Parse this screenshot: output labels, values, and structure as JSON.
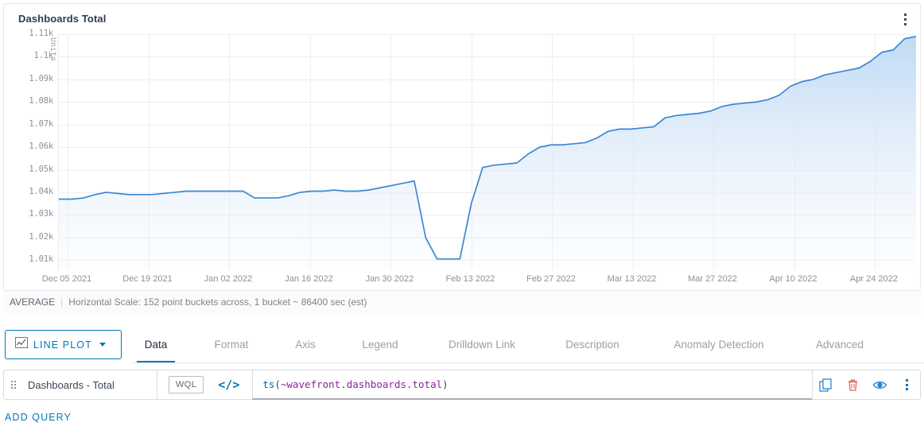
{
  "chart_card": {
    "title": "Dashboards Total",
    "menu_icon": "kebab-menu-icon"
  },
  "chart_data": {
    "type": "area",
    "title": "Dashboards Total",
    "xlabel": "",
    "ylabel": "Units",
    "ylim": [
      1005,
      1115
    ],
    "ytick_labels": [
      "1.11k",
      "1.1k",
      "1.09k",
      "1.08k",
      "1.07k",
      "1.06k",
      "1.05k",
      "1.04k",
      "1.03k",
      "1.02k",
      "1.01k"
    ],
    "ytick_values": [
      1110,
      1100,
      1090,
      1080,
      1070,
      1060,
      1050,
      1040,
      1030,
      1020,
      1010
    ],
    "xtick_labels": [
      "Dec 05 2021",
      "Dec 19 2021",
      "Jan 02 2022",
      "Jan 16 2022",
      "Jan 30 2022",
      "Feb 13 2022",
      "Feb 27 2022",
      "Mar 13 2022",
      "Mar 27 2022",
      "Apr 10 2022",
      "Apr 24 2022"
    ],
    "grid": true,
    "legend": "none",
    "series": [
      {
        "name": "Dashboards - Total",
        "color": "#3a87d4",
        "fill_color": "#cfe2f6",
        "x": [
          "2021-11-30",
          "2021-12-02",
          "2021-12-04",
          "2021-12-06",
          "2021-12-08",
          "2021-12-10",
          "2021-12-12",
          "2021-12-14",
          "2021-12-16",
          "2021-12-18",
          "2021-12-20",
          "2021-12-22",
          "2021-12-24",
          "2021-12-26",
          "2021-12-28",
          "2021-12-30",
          "2022-01-01",
          "2022-01-03",
          "2022-01-05",
          "2022-01-07",
          "2022-01-09",
          "2022-01-11",
          "2022-01-13",
          "2022-01-15",
          "2022-01-17",
          "2022-01-19",
          "2022-01-21",
          "2022-01-23",
          "2022-01-25",
          "2022-01-27",
          "2022-01-29",
          "2022-01-31",
          "2022-02-02",
          "2022-02-04",
          "2022-02-06",
          "2022-02-08",
          "2022-02-10",
          "2022-02-12",
          "2022-02-14",
          "2022-02-16",
          "2022-02-18",
          "2022-02-20",
          "2022-02-22",
          "2022-02-24",
          "2022-02-26",
          "2022-02-28",
          "2022-03-02",
          "2022-03-04",
          "2022-03-06",
          "2022-03-08",
          "2022-03-10",
          "2022-03-12",
          "2022-03-14",
          "2022-03-16",
          "2022-03-18",
          "2022-03-20",
          "2022-03-22",
          "2022-03-24",
          "2022-03-26",
          "2022-03-28",
          "2022-03-30",
          "2022-04-01",
          "2022-04-03",
          "2022-04-05",
          "2022-04-07",
          "2022-04-09",
          "2022-04-11",
          "2022-04-13",
          "2022-04-15",
          "2022-04-17",
          "2022-04-19",
          "2022-04-21",
          "2022-04-23",
          "2022-04-25",
          "2022-04-27",
          "2022-04-29",
          "2022-05-01"
        ],
        "values": [
          1037,
          1037,
          1037,
          1037.5,
          1039,
          1040,
          1039.5,
          1039,
          1039,
          1039,
          1039.5,
          1040,
          1040.5,
          1040.5,
          1040.5,
          1040.5,
          1040.5,
          1040.5,
          1037.5,
          1037.5,
          1037.5,
          1038.5,
          1040,
          1040.5,
          1040.5,
          1041,
          1040.5,
          1040.5,
          1041,
          1042,
          1043,
          1044,
          1045,
          1020,
          1010.5,
          1010.5,
          1010.5,
          1035,
          1051,
          1052,
          1052.5,
          1053,
          1057,
          1060,
          1061,
          1061,
          1061.5,
          1062,
          1064,
          1067,
          1068,
          1068,
          1068.5,
          1069,
          1073,
          1074,
          1074.5,
          1075,
          1076,
          1078,
          1079,
          1079.5,
          1080,
          1081,
          1083,
          1087,
          1089,
          1090,
          1092,
          1093,
          1094,
          1095,
          1098,
          1102,
          1103,
          1108,
          1109
        ]
      }
    ]
  },
  "chart_footer": {
    "aggregation": "AVERAGE",
    "separator": "|",
    "scale_text": "Horizontal Scale: 152 point buckets across, 1 bucket ~ 86400 sec (est)"
  },
  "plot_type": {
    "label": "LINE PLOT",
    "icon": "line-chart-icon",
    "chevron": "chevron-down-icon"
  },
  "tabs": [
    {
      "label": "Data",
      "active": true
    },
    {
      "label": "Format",
      "active": false
    },
    {
      "label": "Axis",
      "active": false
    },
    {
      "label": "Legend",
      "active": false
    },
    {
      "label": "Drilldown Link",
      "active": false
    },
    {
      "label": "Description",
      "active": false
    },
    {
      "label": "Anomaly Detection",
      "active": false
    },
    {
      "label": "Advanced",
      "active": false
    }
  ],
  "query": {
    "drag_handle_icon": "drag-handle-icon",
    "name": "Dashboards - Total",
    "language_badge": "WQL",
    "code_icon": "</>",
    "expression_fn": "ts",
    "expression_open": "(",
    "expression_metric": "~wavefront.dashboards.total",
    "expression_close": ")",
    "expression_full": "ts(~wavefront.dashboards.total)",
    "actions": [
      {
        "name": "clone-query-icon",
        "color": "#0079b8"
      },
      {
        "name": "delete-query-icon",
        "color": "#e8635c"
      },
      {
        "name": "toggle-visibility-icon",
        "color": "#0079b8"
      },
      {
        "name": "query-menu-icon",
        "color": "#0079b8"
      }
    ]
  },
  "add_query": {
    "label": "ADD QUERY"
  },
  "colors": {
    "accent": "#0079b8",
    "line": "#3a87d4",
    "danger": "#e8635c",
    "grid": "#ededee",
    "text": "#3c4752",
    "muted": "#8a9199"
  }
}
